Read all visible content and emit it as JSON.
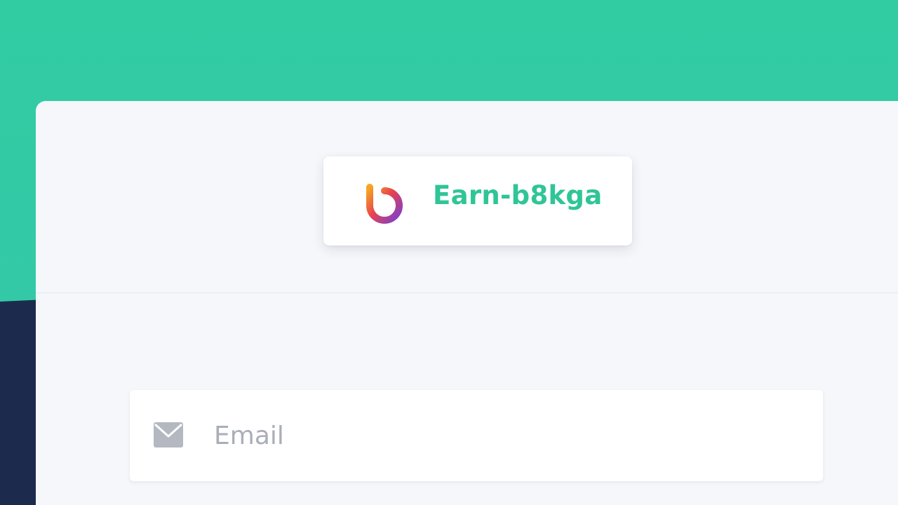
{
  "brand": {
    "name": "Earn-b8kga",
    "logo_icon": "brand-logo-icon"
  },
  "login_form": {
    "email_placeholder": "Email",
    "email_value": "",
    "email_icon": "envelope-icon"
  },
  "colors": {
    "accent_green": "#31cca2",
    "brand_text": "#2fc597",
    "navy_background": "#1c2b4d",
    "card_background": "#f5f7fa",
    "placeholder_gray": "#a9aeb8"
  }
}
